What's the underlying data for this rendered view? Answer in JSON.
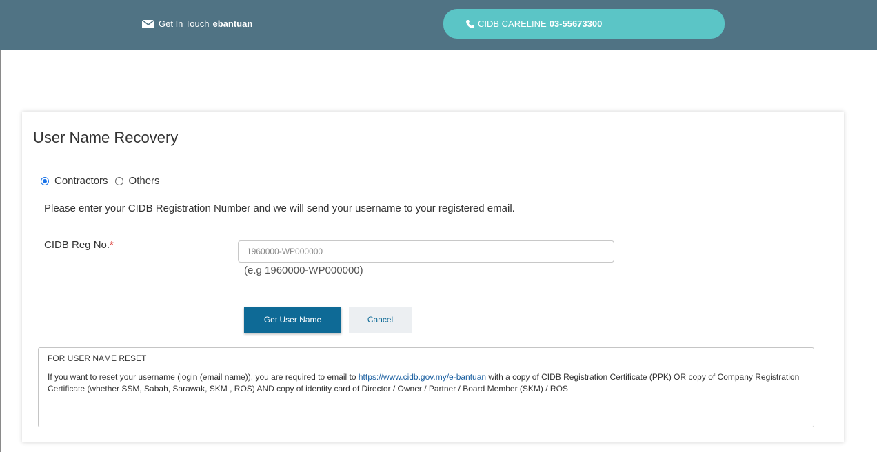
{
  "topbar": {
    "contact_prefix": "Get In Touch",
    "contact_name": "ebantuan",
    "careline_prefix": "CIDB CARELINE",
    "careline_number": "03-55673300",
    "bg_color": "#507384",
    "careline_color": "#5bc5c6"
  },
  "card": {
    "title": "User Name Recovery",
    "radios": [
      {
        "label": "Contractors",
        "checked": true
      },
      {
        "label": "Others",
        "checked": false
      }
    ],
    "instructions": "Please enter your CIDB Registration Number and we will send your username to your registered email.",
    "reg_label": "CIDB Reg No.",
    "required_mark": "*",
    "reg_placeholder": "1960000-WP000000",
    "reg_hint": "(e.g 1960000-WP000000)",
    "submit_label": "Get User Name",
    "cancel_label": "Cancel"
  },
  "notice": {
    "title": "FOR USER NAME RESET",
    "text_before": "If you want to reset your username (login (email name)), you are required to email to ",
    "link": "https://www.cidb.gov.my/e-bantuan",
    "text_after": " with a copy of CIDB Registration Certificate (PPK) OR copy of Company Registration Certificate (whether SSM, Sabah, Sarawak, SKM , ROS) AND copy of identity card of Director / Owner / Partner / Board Member (SKM) / ROS"
  },
  "icons": {
    "contact": "envelope-icon",
    "careline": "phone-icon"
  }
}
